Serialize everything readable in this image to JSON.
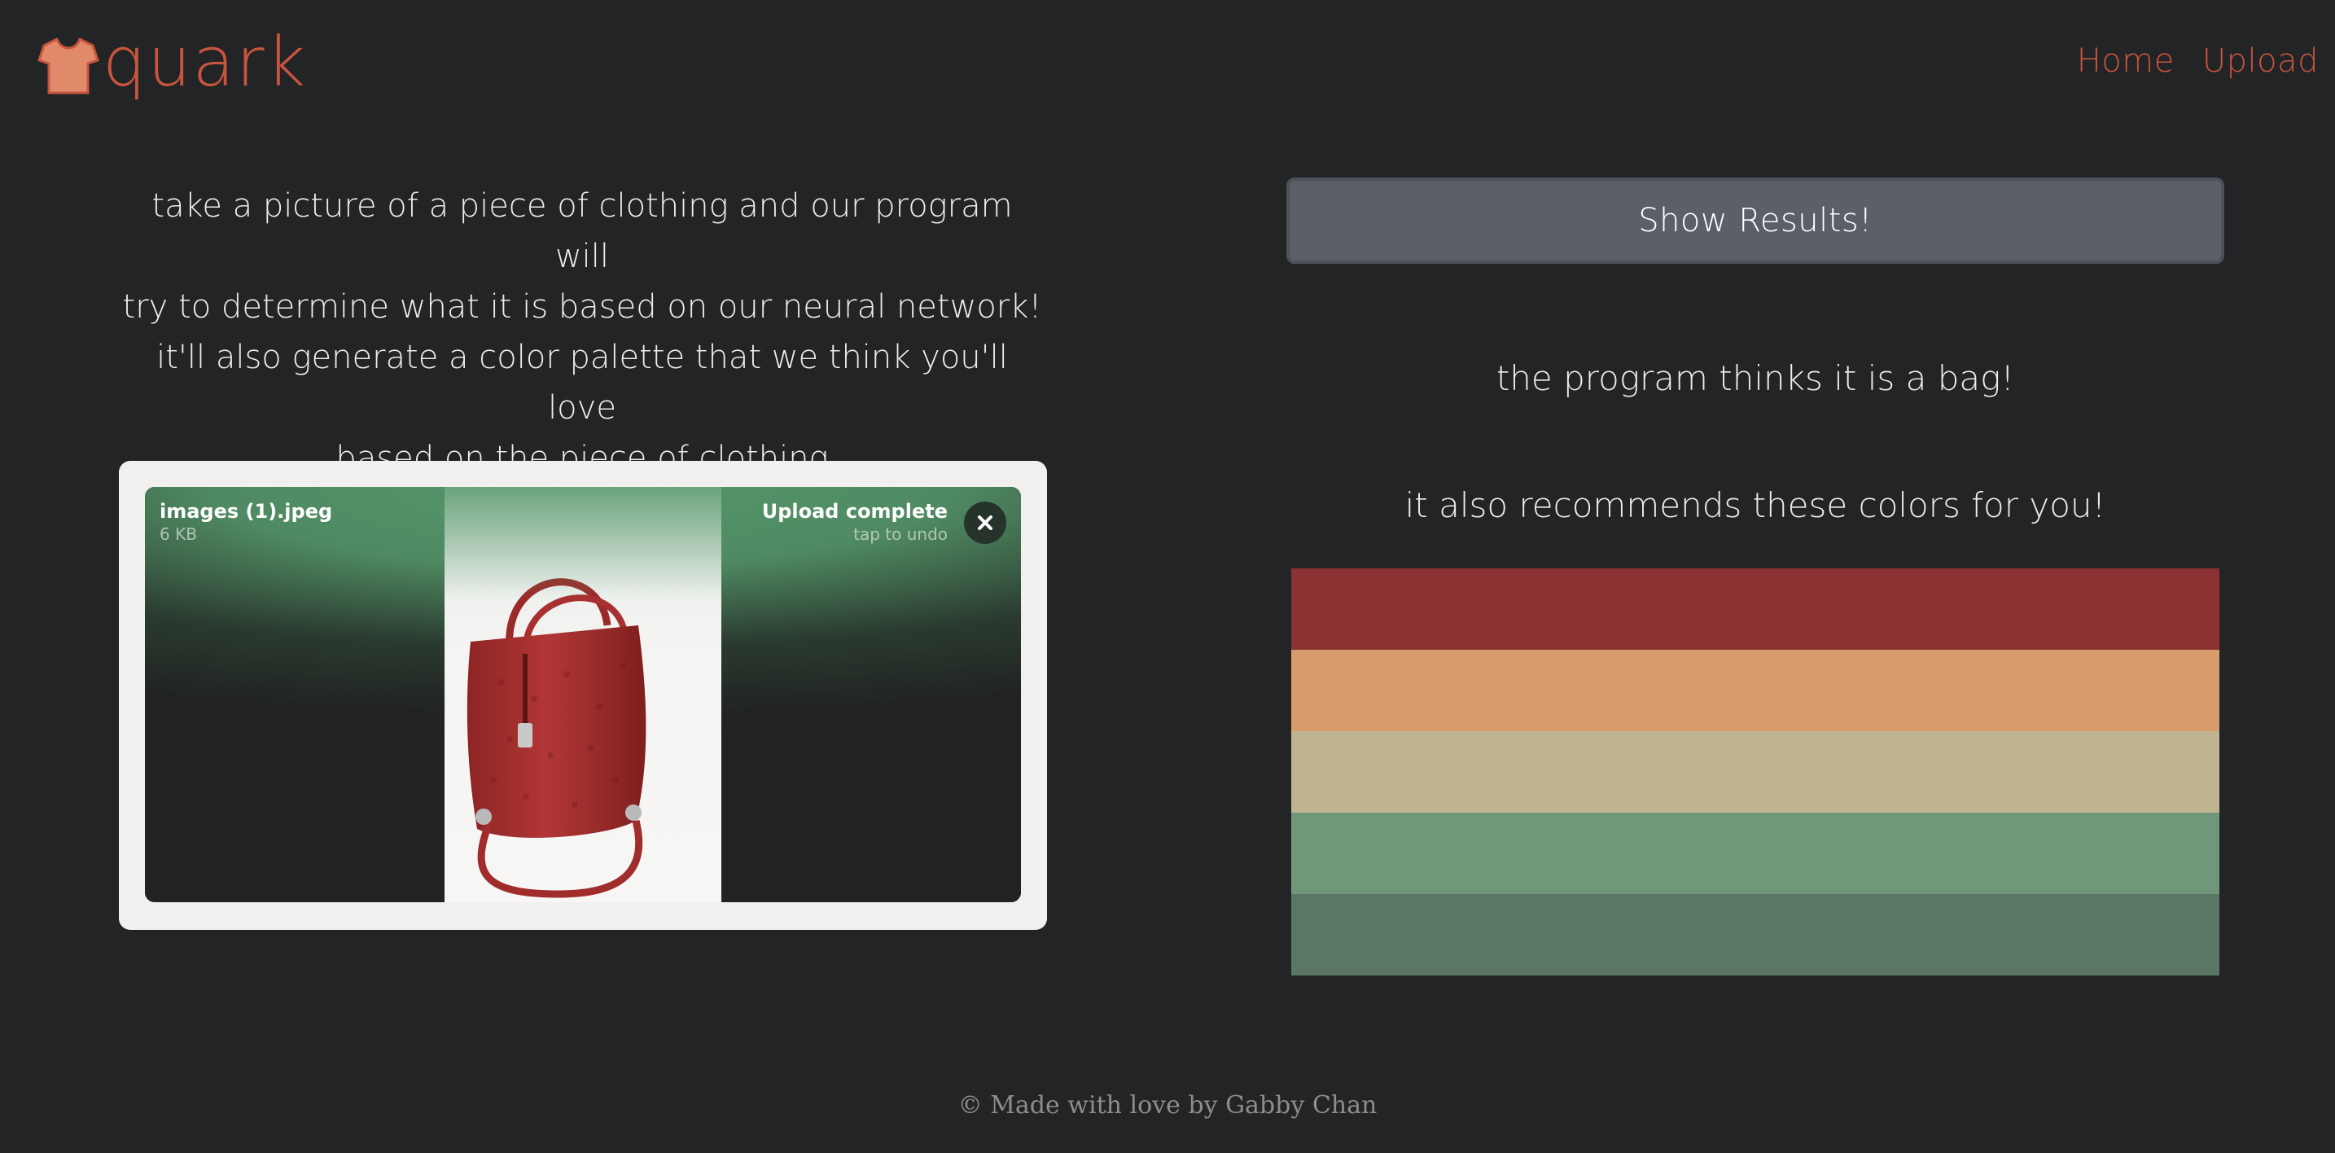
{
  "header": {
    "logo_text": "quark",
    "nav": [
      {
        "label": "Home"
      },
      {
        "label": "Upload"
      }
    ]
  },
  "description": {
    "lines": [
      "take a picture of a piece of clothing and our program will",
      "try to determine what it is based on our neural network!",
      "it'll also generate a color palette that we think you'll love",
      "based on the piece of clothing"
    ]
  },
  "upload": {
    "file_name": "images (1).jpeg",
    "file_size": "6 KB",
    "status": "Upload complete",
    "status_hint": "tap to undo"
  },
  "results": {
    "button_label": "Show Results!",
    "prediction_text": "the program thinks it is a bag!",
    "recommend_text": "it also recommends these colors for you!",
    "palette": [
      "#8b3333",
      "#d79b6c",
      "#bfb691",
      "#71977b",
      "#5a7664"
    ]
  },
  "footer": {
    "text": "© Made with love by Gabby Chan"
  },
  "colors": {
    "accent": "#c8553d",
    "background": "#232426"
  }
}
